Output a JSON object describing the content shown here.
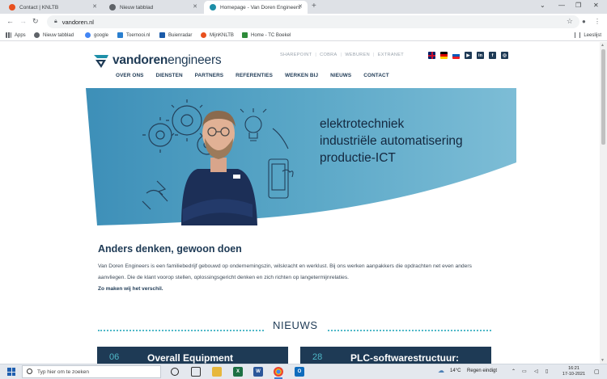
{
  "browser": {
    "tabs": [
      {
        "title": "Contact | KNLTB",
        "favicon_color": "#e8501e"
      },
      {
        "title": "Nieuw tabblad",
        "favicon_color": "#5f6368"
      },
      {
        "title": "Homepage - Van Doren Engineers",
        "favicon_color": "#1e8fa8"
      }
    ],
    "url": "vandoren.nl",
    "bookmarks": [
      {
        "label": "Apps",
        "color": "#5f6368"
      },
      {
        "label": "Nieuw tabblad",
        "color": "#5f6368"
      },
      {
        "label": "google",
        "color": "#4285f4"
      },
      {
        "label": "Toernooi.nl",
        "color": "#2a7fcf"
      },
      {
        "label": "Buienradar",
        "color": "#1a5aa8"
      },
      {
        "label": "MijnKNLTB",
        "color": "#e8501e"
      },
      {
        "label": "Home - TC Boekel",
        "color": "#2e8b3a"
      }
    ],
    "reading_list": "Leeslijst"
  },
  "site": {
    "logo": {
      "bold": "vandoren",
      "light": "engineers"
    },
    "top_links": [
      "SHAREPOINT",
      "COBRA",
      "WEBUREN",
      "EXTRANET"
    ],
    "social": [
      {
        "icon": "flag-uk-icon",
        "label": ""
      },
      {
        "icon": "flag-de-icon",
        "label": ""
      },
      {
        "icon": "flag-si-icon",
        "label": ""
      },
      {
        "icon": "youtube-icon",
        "label": "▶"
      },
      {
        "icon": "linkedin-icon",
        "label": "in"
      },
      {
        "icon": "facebook-icon",
        "label": "f"
      },
      {
        "icon": "instagram-icon",
        "label": "◎"
      }
    ],
    "nav": [
      "OVER ONS",
      "DIENSTEN",
      "PARTNERS",
      "REFERENTIES",
      "WERKEN BIJ",
      "NIEUWS",
      "CONTACT"
    ],
    "hero_lines": [
      "elektrotechniek",
      "industriële automatisering",
      "productie-ICT"
    ],
    "heading": "Anders denken, gewoon doen",
    "intro": "Van Doren Engineers is een familiebedrijf gebouwd op ondernemingszin, wilskracht en werklust. Bij ons werken aanpakkers die opdrachten net even anders aanvliegen. Die de klant voorop stellen, oplossingsgericht denken en zich richten op langetermijnrelaties.",
    "tagline": "Zo maken wij het verschil.",
    "news_title": "NIEUWS",
    "news": [
      {
        "num": "06",
        "title": "Overall Equipment"
      },
      {
        "num": "28",
        "title": "PLC-softwarestructuur:"
      }
    ],
    "accent_color": "#4fb8c8",
    "brand_color": "#1e3a55"
  },
  "taskbar": {
    "search_placeholder": "Typ hier om te zoeken",
    "weather_temp": "14°C",
    "weather_text": "Regen eindigt",
    "time": "16:21",
    "date": "17-10-2021"
  }
}
